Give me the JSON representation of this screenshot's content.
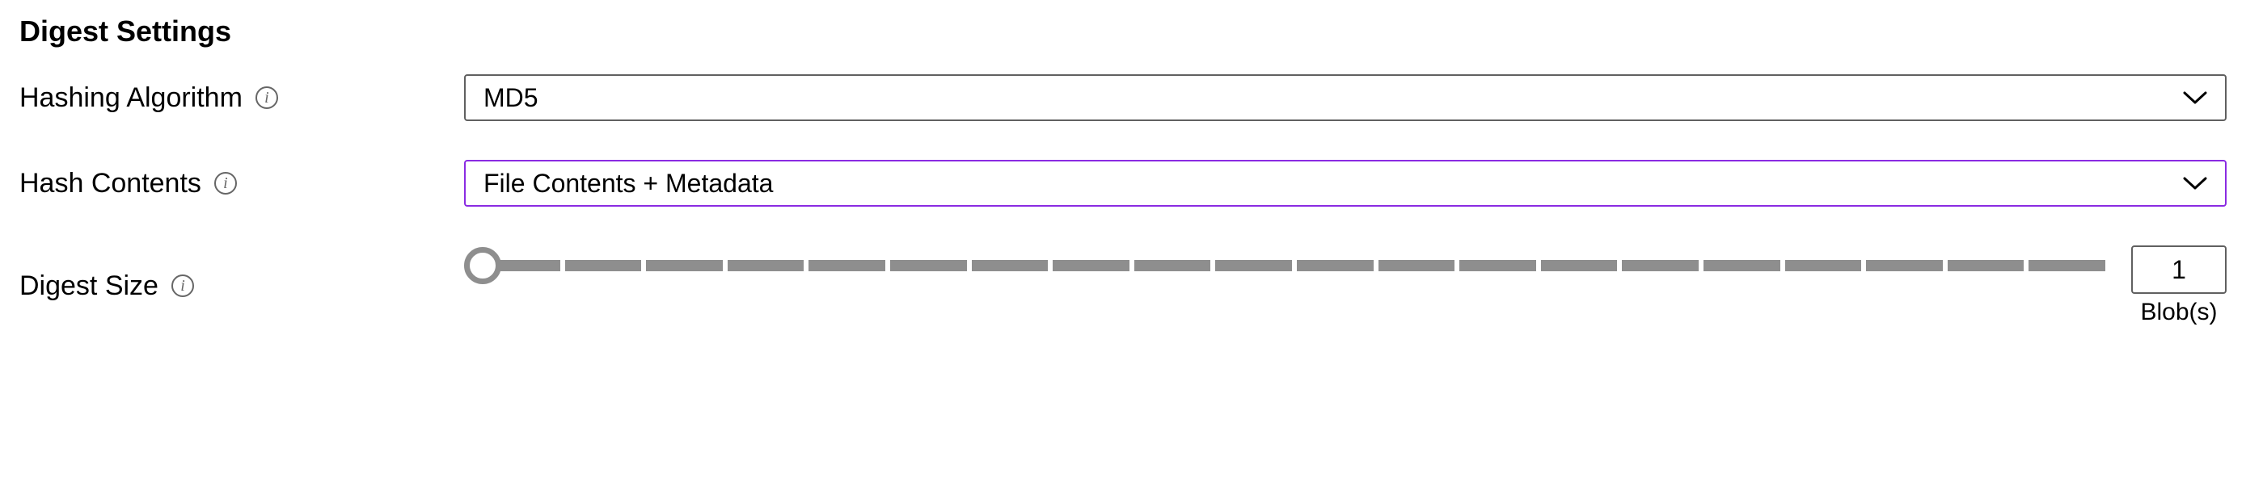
{
  "section": {
    "title": "Digest Settings"
  },
  "algorithm": {
    "label": "Hashing Algorithm",
    "value": "MD5"
  },
  "contents": {
    "label": "Hash Contents",
    "value": "File Contents + Metadata"
  },
  "size": {
    "label": "Digest Size",
    "value": "1",
    "unit": "Blob(s)",
    "ticks": 20
  },
  "colors": {
    "accent": "#8a2be2",
    "border": "#606060",
    "tick": "#8e8e8e"
  }
}
